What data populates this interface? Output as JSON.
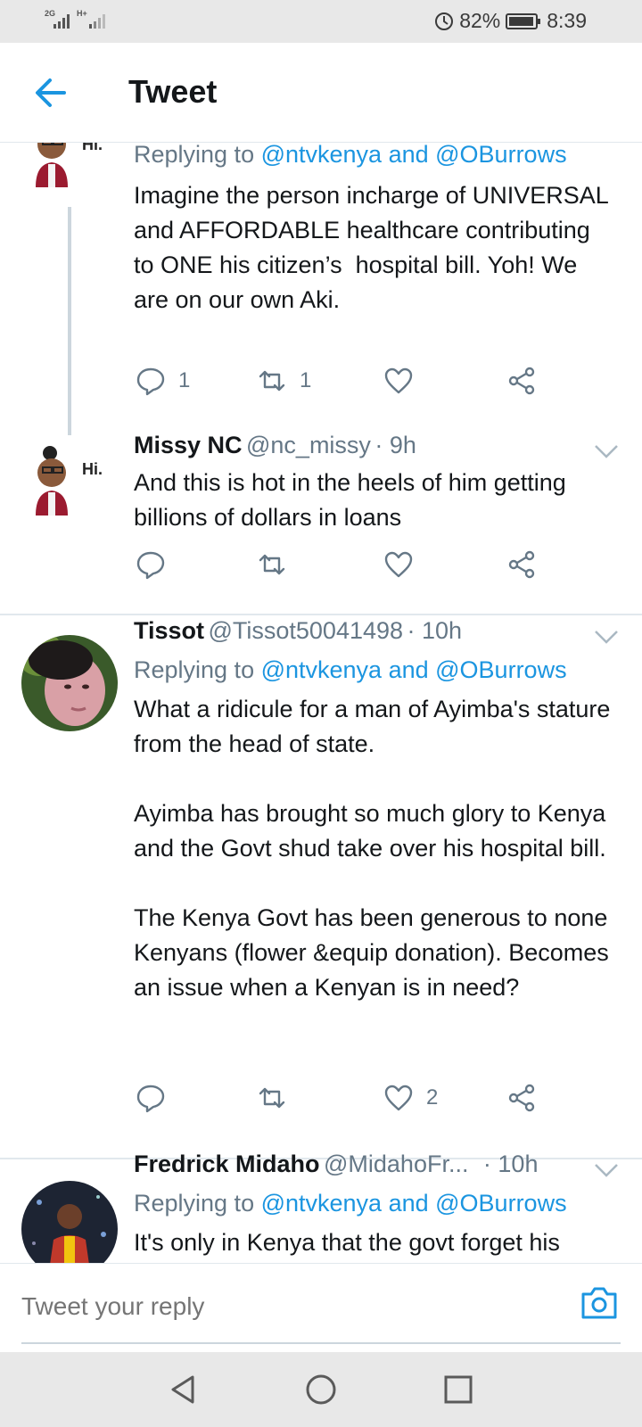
{
  "status_bar": {
    "network_1": "2G",
    "network_2": "H+",
    "battery_percent": "82%",
    "time": "8:39"
  },
  "header": {
    "title": "Tweet"
  },
  "tweets": [
    {
      "replying_prefix": "Replying to ",
      "mention_1": "@ntvkenya",
      "mention_join": " and ",
      "mention_2": "@OBurrows",
      "text": "Imagine the person incharge of UNIVERSAL and AFFORDABLE healthcare contributing to ONE his citizen’s  hospital bill. Yoh! We are on our own Aki.",
      "reply_count": "1",
      "retweet_count": "1",
      "like_count": "",
      "avatar_caption": "Hi."
    },
    {
      "name": "Missy NC",
      "handle": "@nc_missy",
      "time": "· 9h",
      "text": "And this is hot in the heels of him getting billions of dollars in loans",
      "avatar_caption": "Hi."
    },
    {
      "name": "Tissot",
      "handle": "@Tissot50041498",
      "time": "· 10h",
      "replying_prefix": "Replying to ",
      "mention_1": "@ntvkenya",
      "mention_join": " and ",
      "mention_2": "@OBurrows",
      "text": "What a ridicule for a man of Ayimba's stature from the head of state.\n\nAyimba has brought so much glory to Kenya and the Govt shud take over his hospital bill.\n\nThe Kenya Govt has been generous to none Kenyans (flower &equip donation). Becomes an issue when a Kenyan is in need?",
      "like_count": "2"
    },
    {
      "name": "Fredrick Midaho",
      "handle": "@MidahoFr...",
      "time": "· 10h",
      "replying_prefix": "Replying to ",
      "mention_1": "@ntvkenya",
      "mention_join": " and ",
      "mention_2": "@OBurrows",
      "text": "It's only in Kenya that the govt forget his"
    }
  ],
  "reply_bar": {
    "placeholder": "Tweet your reply"
  },
  "colors": {
    "accent": "#1b95e0",
    "secondary_text": "#657786",
    "divider": "#e1e8ed"
  },
  "icons": [
    "back-arrow-icon",
    "reply-icon",
    "retweet-icon",
    "like-icon",
    "share-icon",
    "chevron-down-icon",
    "camera-icon",
    "nav-back-icon",
    "nav-home-icon",
    "nav-recents-icon"
  ]
}
